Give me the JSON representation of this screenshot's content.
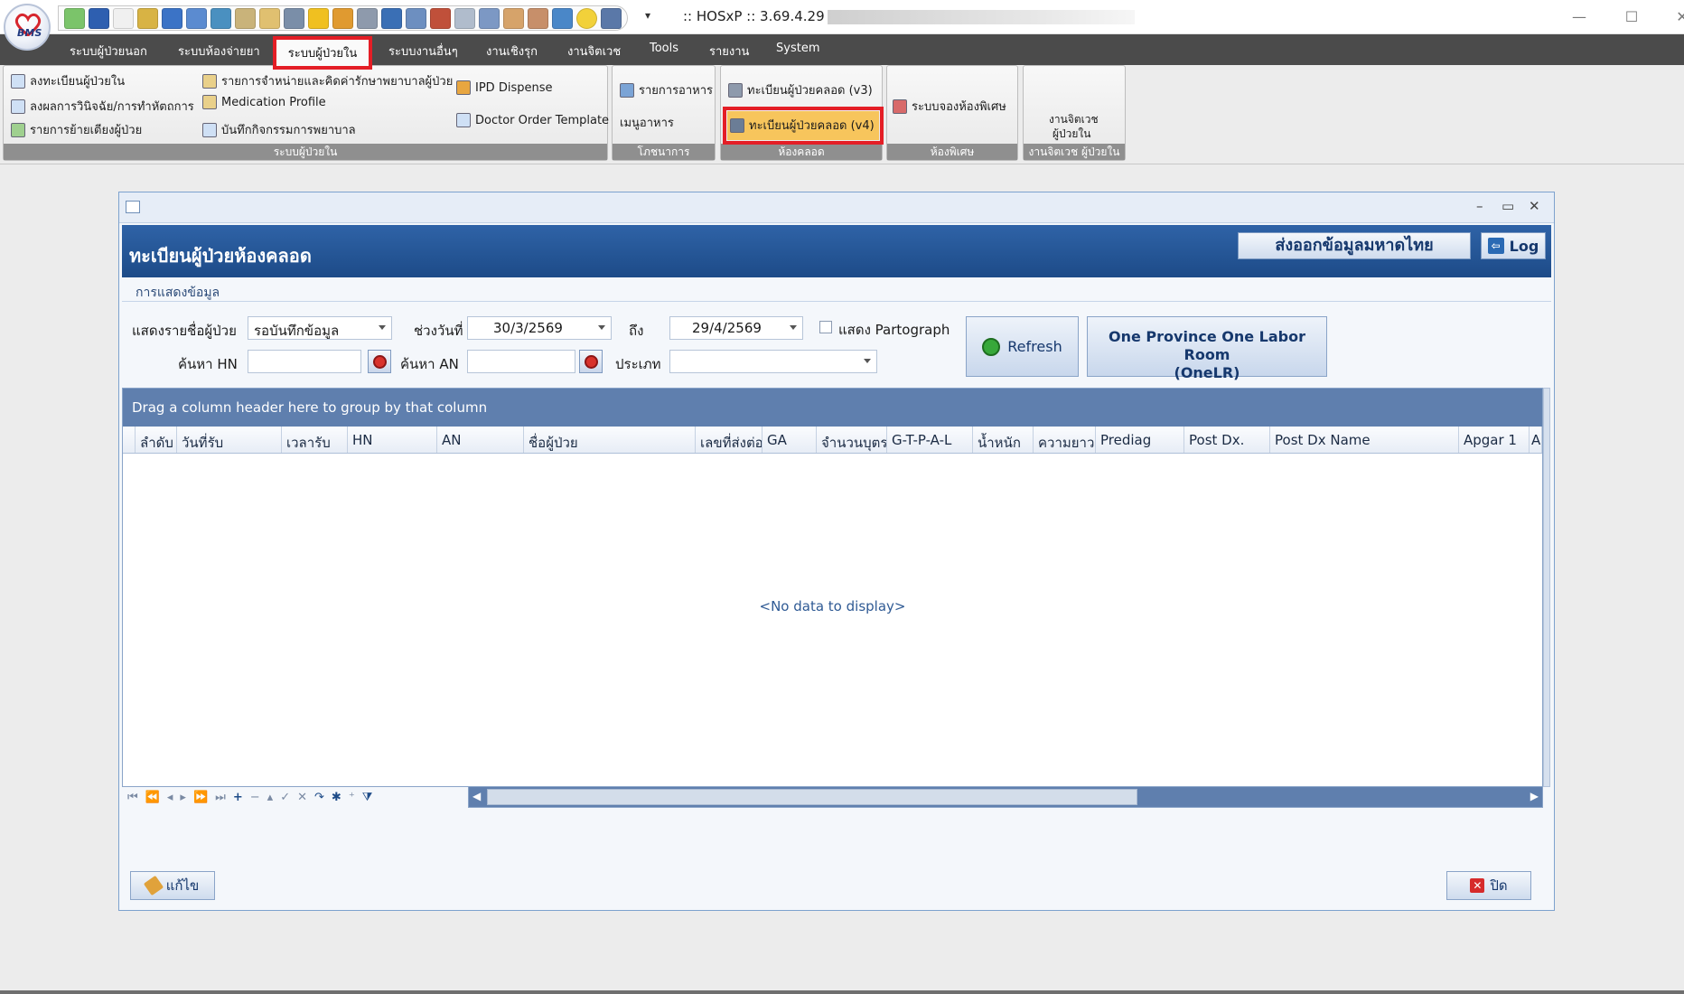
{
  "titlebar": {
    "app_title": ":: HOSxP :: 3.69.4.29 My",
    "logo_text": "BMS",
    "qat_dropdown": "▾",
    "minimize": "—",
    "maximize": "☐",
    "close": "✕"
  },
  "menu": {
    "tabs": [
      "ระบบผู้ป่วยนอก",
      "ระบบห้องจ่ายยา",
      "ระบบผู้ป่วยใน",
      "ระบบงานอื่นๆ",
      "งานเชิงรุก",
      "งานจิตเวช",
      "Tools",
      "รายงาน",
      "System"
    ],
    "active": "ระบบผู้ป่วยใน"
  },
  "ribbon": {
    "group_ipd": {
      "caption": "ระบบผู้ป่วยใน",
      "items": [
        "ลงทะเบียนผู้ป่วยใน",
        "ลงผลการวินิจฉัย/การทำหัตถการ",
        "รายการย้ายเตียงผู้ป่วย",
        "รายการจำหน่ายและคิดค่ารักษาพยาบาลผู้ป่วย",
        "Medication Profile",
        "บันทึกกิจกรรมการพยาบาล",
        "IPD Dispense",
        "Doctor Order Template"
      ]
    },
    "group_nutrition": {
      "caption": "โภชนาการ",
      "items": [
        "รายการอาหาร",
        "เมนูอาหาร"
      ]
    },
    "group_labor": {
      "caption": "ห้องคลอด",
      "items": [
        "ทะเบียนผู้ป่วยคลอด (v3)",
        "ทะเบียนผู้ป่วยคลอด (v4)"
      ]
    },
    "group_special": {
      "caption": "ห้องพิเศษ",
      "items": [
        "ระบบจองห้องพิเศษ"
      ]
    },
    "group_psych": {
      "caption": "งานจิตเวช ผู้ป่วยใน",
      "line1": "งานจิตเวช",
      "line2": "ผู้ป่วยใน"
    }
  },
  "window": {
    "controls": {
      "minimize": "–",
      "maximize": "▭",
      "close": "✕"
    },
    "title": "ทะเบียนผู้ป่วยห้องคลอด",
    "export_button": "ส่งออกข้อมูลมหาดไทย",
    "log_button": "Log",
    "filter_caption": "การแสดงข้อมูล",
    "filter": {
      "show_list_label": "แสดงรายชื่อผู้ป่วย",
      "show_list_value": "รอบันทึกข้อมูล",
      "date_range_label": "ช่วงวันที่",
      "date_from": "30/3/2569",
      "to_label": "ถึง",
      "date_to": "29/4/2569",
      "partograph_label": "แสดง Partograph",
      "hn_label": "ค้นหา HN",
      "hn_value": "",
      "an_label": "ค้นหา AN",
      "an_value": "",
      "type_label": "ประเภท",
      "type_value": ""
    },
    "refresh_button": "Refresh",
    "onelr_button_line1": "One Province One Labor Room",
    "onelr_button_line2": "(OneLR)",
    "grid": {
      "group_hint": "Drag a column header here to group by that column",
      "columns": [
        "ลำดับ",
        "วันที่รับ",
        "เวลารับ",
        "HN",
        "AN",
        "ชื่อผู้ป่วย",
        "เลขที่ส่งต่อ",
        "GA",
        "จำนวนบุตร",
        "G-T-P-A-L",
        "น้ำหนัก",
        "ความยาว",
        "Prediag",
        "Post Dx.",
        "Post Dx Name",
        "Apgar 1",
        "A"
      ],
      "empty_text": "<No data to display>"
    },
    "navigator": [
      "⏮",
      "⏪",
      "◂",
      "▸",
      "⏩",
      "⏭",
      "+",
      "−",
      "▴",
      "✓",
      "✕",
      "↷",
      "✱",
      "⁺",
      "⧩"
    ],
    "edit_button": "แก้ไข",
    "close_button": "ปิด"
  },
  "colors": {
    "header_blue": "#1d4b88",
    "highlight_red": "#e41e26",
    "highlight_orange": "#f7c55c"
  }
}
